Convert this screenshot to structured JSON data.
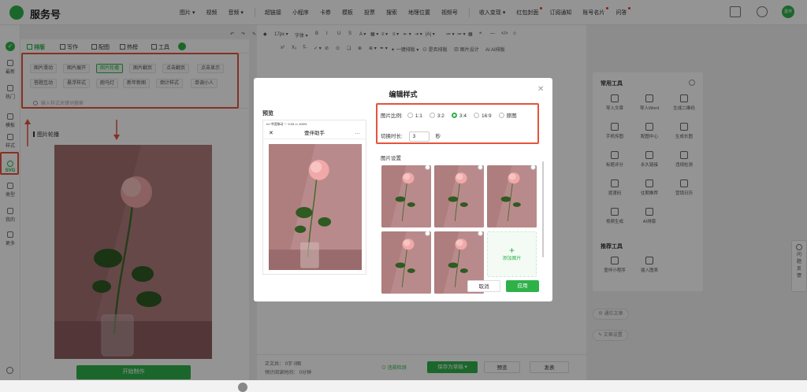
{
  "app": {
    "title": "服务号",
    "avatar_text": "曼伴"
  },
  "topnav": {
    "items": [
      {
        "label": "图片 ▾",
        "dot": false
      },
      {
        "label": "视频",
        "dot": false
      },
      {
        "label": "音频 ▾",
        "dot": false
      },
      {
        "label": "超链接",
        "dot": false
      },
      {
        "label": "小程序",
        "dot": false
      },
      {
        "label": "卡券",
        "dot": false
      },
      {
        "label": "模板",
        "dot": false
      },
      {
        "label": "投票",
        "dot": false
      },
      {
        "label": "搜索",
        "dot": false
      },
      {
        "label": "地理位置",
        "dot": false
      },
      {
        "label": "视频号",
        "dot": false
      },
      {
        "label": "收入变现 ▾",
        "dot": false
      },
      {
        "label": "红包封面",
        "dot": true
      },
      {
        "label": "订阅通知",
        "dot": false
      },
      {
        "label": "账号名片",
        "dot": true
      },
      {
        "label": "问答",
        "dot": true
      }
    ]
  },
  "rail": {
    "items": [
      "最新",
      "热门",
      "模板",
      "样式",
      "SVG",
      "类型",
      "我的",
      "更多"
    ]
  },
  "left_tabs": [
    "排版",
    "写作",
    "配图",
    "热榜",
    "工具"
  ],
  "style_tags": {
    "row1": [
      "图片滑动",
      "图片展开",
      "图片轮播",
      "图片翻页",
      "点击翻页",
      "点击显示"
    ],
    "row2": [
      "答题互动",
      "悬浮样式",
      "跑马灯",
      "新年新图",
      "倒计样式",
      "单调小人"
    ],
    "active": "图片轮播",
    "search_placeholder": "输入样式关键词搜索"
  },
  "left_section_title": "图片轮播",
  "start_button": "开始制作",
  "editor_toolbar": {
    "row1": [
      "↶",
      "↷",
      "✎",
      "◆",
      "17px ▾",
      "字体 ▾",
      "B",
      "I",
      "U",
      "S",
      "A ▾",
      "▦ ▾",
      "≡ ▾",
      "≡ ▾",
      "⇤ ▾",
      "⇥ ▾",
      "|A| ▾",
      "≔ ▾",
      "≔ ▾",
      "▦",
      "❝",
      "—",
      "</>",
      "☺"
    ],
    "row2": [
      "x²",
      "X₂",
      "T̶",
      "✓ ▾",
      "⊘",
      "⊙",
      "❏",
      "⊕",
      "⊕ ▾",
      "✒ ▾",
      "✦ 一键排版 ▾",
      "⊙ 是否排版",
      "▧ 图片设计",
      "AI AI排版"
    ]
  },
  "editor_footer": {
    "word_count": "正文共：   0字 0图",
    "read_time": "预计阅读时间：  0分钟",
    "check_label": "违规检测",
    "save_draft": "保存为草稿",
    "preview": "预览",
    "publish": "发表"
  },
  "right_panel": {
    "common_title": "常用工具",
    "common_items": [
      "导入文章",
      "导入Word",
      "生成二维码",
      "手机传图",
      "配图中心",
      "生成长图",
      "标题评分",
      "永久链接",
      "违规检测",
      "渡渡码",
      "往期推荐",
      "营销日历",
      "视频生成",
      "AI排版"
    ],
    "recommended_title": "推荐工具",
    "recommended_items": [
      "壹伴小程序",
      "插入图表"
    ],
    "pill1": "⊕ 通位文章",
    "pill2": "✎ 文章设置"
  },
  "help": {
    "label": "问题反馈"
  },
  "modal": {
    "title": "编辑样式",
    "preview_label": "预览",
    "phone_status": "▪▪▪ 中国移动 ⌔    9:33     ▭ 100%",
    "phone_title": "壹伴助手",
    "ratio_label": "图片比例:",
    "ratio_options": [
      "1:1",
      "3:2",
      "3:4",
      "16:9",
      "原图"
    ],
    "ratio_selected": "3:4",
    "interval_label": "切换时长:",
    "interval_value": "3",
    "interval_unit": "秒",
    "image_settings_label": "图片设置",
    "image_count": 5,
    "add_image": "添加图片",
    "cancel": "取消",
    "apply": "应用"
  }
}
